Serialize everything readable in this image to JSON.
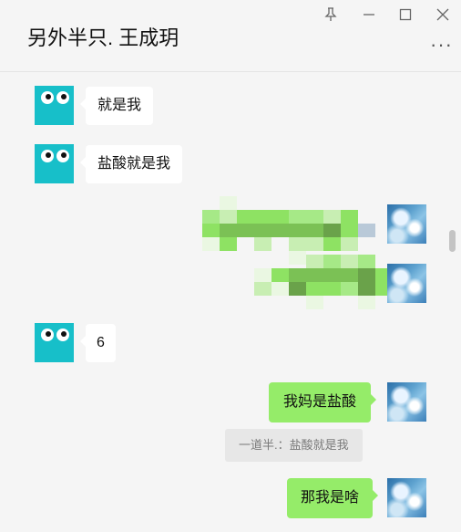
{
  "header": {
    "title": "另外半只. 王成玥",
    "pin_icon": "pin-icon",
    "minimize_icon": "minimize-icon",
    "maximize_icon": "maximize-icon",
    "close_icon": "close-icon",
    "more_icon": "more-icon"
  },
  "messages": [
    {
      "side": "left",
      "text": "就是我"
    },
    {
      "side": "left",
      "text": "盐酸就是我"
    },
    {
      "side": "right",
      "type": "pixelated",
      "text": ""
    },
    {
      "side": "right",
      "type": "pixelated",
      "text": ""
    },
    {
      "side": "left",
      "text": "6"
    },
    {
      "side": "right",
      "text": "我妈是盐酸",
      "quote": "一道半.：盐酸就是我"
    },
    {
      "side": "right",
      "text": "那我是啥"
    }
  ],
  "colors": {
    "background": "#f5f5f5",
    "left_bubble": "#ffffff",
    "right_bubble": "#95ec69",
    "avatar_left": "#17bfc9"
  }
}
